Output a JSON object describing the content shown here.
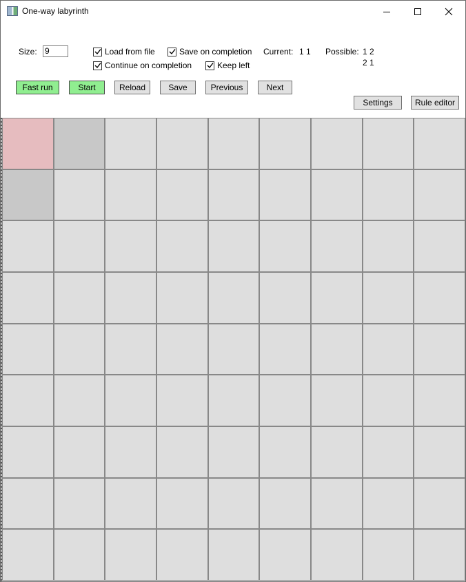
{
  "window": {
    "title": "One-way labyrinth",
    "icon": "app-icon",
    "controls": [
      "minimize-icon",
      "maximize-icon",
      "close-icon"
    ]
  },
  "options": {
    "size_label": "Size:",
    "size_value": "9",
    "load_from_file": {
      "label": "Load from file",
      "checked": true
    },
    "save_on_completion": {
      "label": "Save on completion",
      "checked": true
    },
    "continue_on_completion": {
      "label": "Continue on completion",
      "checked": true
    },
    "keep_left": {
      "label": "Keep left",
      "checked": true
    },
    "current_label": "Current:",
    "current_value": "1 1",
    "possible_label": "Possible:",
    "possible_values": [
      "1 2",
      "2 1"
    ]
  },
  "buttons": {
    "fast_run": "Fast run",
    "start": "Start",
    "reload": "Reload",
    "save": "Save",
    "previous": "Previous",
    "next": "Next",
    "settings": "Settings",
    "rule_editor": "Rule editor"
  },
  "colors": {
    "green_button": "#90ee90",
    "start_cell": "#e6bcbf",
    "visited_cell": "#c8c8c8",
    "empty_cell": "#dedede",
    "grid_line": "#888888"
  },
  "grid": {
    "rows": 9,
    "cols": 9,
    "start_cells": [
      [
        1,
        1
      ]
    ],
    "visited_cells": [
      [
        1,
        2
      ],
      [
        2,
        1
      ]
    ]
  }
}
